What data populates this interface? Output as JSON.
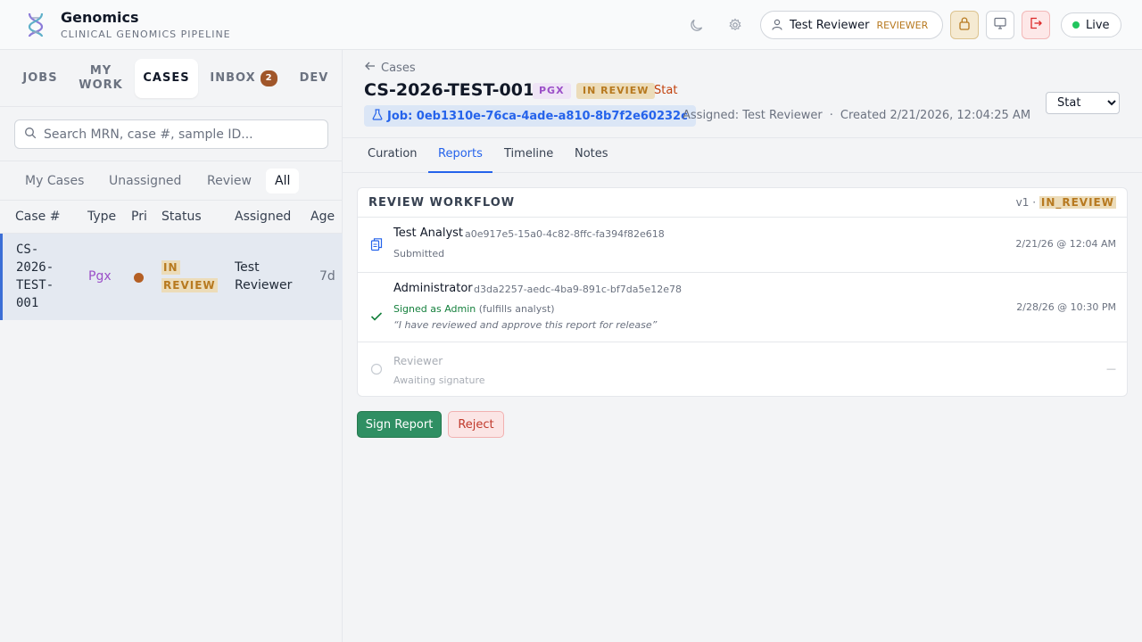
{
  "colors": {
    "accent": "#2563eb",
    "reviewer_role": "#b7791f",
    "live": "#22c55e",
    "pgx": "#9b4fc8",
    "in_review": "#b7791f",
    "stat": "#c2410c",
    "sign_button": "#2f8f63",
    "reject_button": "#c0392b",
    "priority_dot": "#b45f24"
  },
  "header": {
    "app_name": "Genomics",
    "app_subtitle": "CLINICAL GENOMICS PIPELINE",
    "icons": [
      "dna-logo-icon",
      "moon-icon",
      "gear-icon",
      "lock-icon",
      "monitor-icon",
      "logout-icon"
    ],
    "user_name": "Test Reviewer",
    "user_role": "REVIEWER",
    "live_label": "Live"
  },
  "sidebar": {
    "nav": {
      "jobs": "JOBS",
      "my_work_line1": "MY",
      "my_work_line2": "WORK",
      "cases": "CASES",
      "inbox": "INBOX",
      "inbox_count": "2",
      "dev": "DEV"
    },
    "search_placeholder": "Search MRN, case #, sample ID...",
    "filters": [
      "My Cases",
      "Unassigned",
      "Review",
      "All"
    ],
    "columns": [
      "Case #",
      "Type",
      "Pri",
      "Status",
      "Assigned",
      "Age"
    ],
    "rows": [
      {
        "case": "CS-2026-TEST-001",
        "type": "Pgx",
        "status_line1": "IN",
        "status_line2": "REVIEW",
        "assigned": "Test Reviewer",
        "age": "7d"
      }
    ]
  },
  "case": {
    "back_label": "Cases",
    "id": "CS-2026-TEST-001",
    "type_badge": "PGX",
    "status_badge": "IN REVIEW",
    "priority_text": "Stat",
    "job_label": "Job: 0eb1310e-76ca-4ade-a810-8b7f2e60232c",
    "assigned": "Assigned: Test Reviewer",
    "separator": "·",
    "created": "Created 2/21/2026, 12:04:25 AM",
    "priority_select": "Stat"
  },
  "tabs": [
    "Curation",
    "Reports",
    "Timeline",
    "Notes"
  ],
  "workflow": {
    "title": "REVIEW WORKFLOW",
    "version_prefix": "v1 ·",
    "version_status": "IN_REVIEW",
    "steps": [
      {
        "name": "Test Analyst",
        "id": "a0e917e5-15a0-4c82-8ffc-fa394f82e618",
        "sub": "Submitted",
        "time": "2/21/26 @ 12:04 AM"
      },
      {
        "name": "Administrator",
        "id": "d3da2257-aedc-4ba9-891c-bf7da5e12e78",
        "signed": "Signed as Admin",
        "fulfils": "(fulfills analyst)",
        "quote": "“I have reviewed and approve this report for release”",
        "time": "2/28/26 @ 10:30 PM"
      },
      {
        "name": "Reviewer",
        "sub": "Awaiting signature",
        "time": "—"
      }
    ]
  },
  "actions": {
    "sign": "Sign Report",
    "reject": "Reject"
  }
}
